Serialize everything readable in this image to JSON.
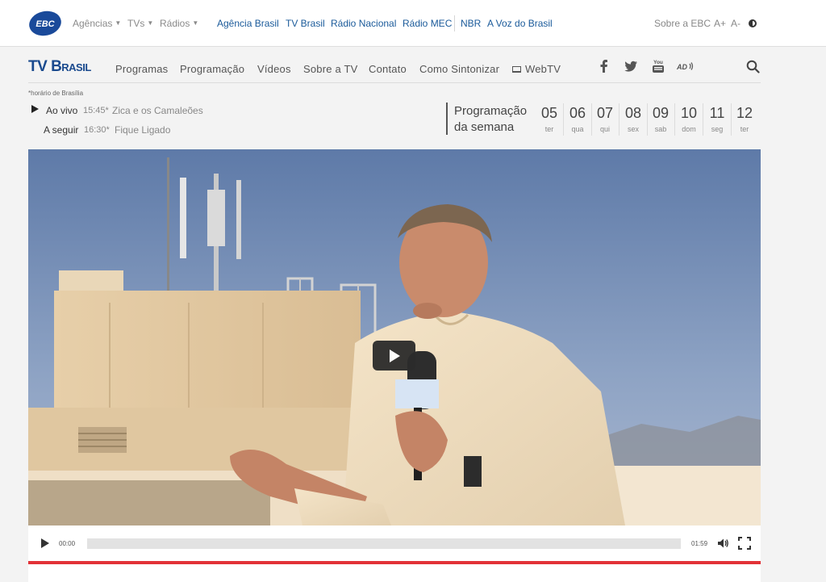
{
  "topbar": {
    "logo_text": "EBC",
    "dropdowns": [
      "Agências",
      "TVs",
      "Rádios"
    ],
    "links": [
      "Agência Brasil",
      "TV Brasil",
      "Rádio Nacional",
      "Rádio MEC",
      "NBR",
      "A Voz do Brasil"
    ],
    "about": "Sobre a EBC",
    "font_plus": "A+",
    "font_minus": "A-"
  },
  "nav": {
    "logo_main": "TV",
    "logo_sub": "Brasil",
    "items": [
      "Programas",
      "Programação",
      "Vídeos",
      "Sobre a TV",
      "Contato",
      "Como Sintonizar",
      "WebTV"
    ],
    "social_icons": [
      "facebook-icon",
      "twitter-icon",
      "youtube-icon",
      "audio-description-icon"
    ],
    "youtube_text": "You",
    "ad_text": "AD"
  },
  "schedule": {
    "timezone_note": "*horário de Brasília",
    "live_label": "Ao vivo",
    "live_time": "15:45*",
    "live_title": "Zica e os Camaleões",
    "next_label": "A seguir",
    "next_time": "16:30*",
    "next_title": "Fique Ligado",
    "week_title_1": "Programação",
    "week_title_2": "da semana",
    "days": [
      {
        "num": "05",
        "wd": "ter"
      },
      {
        "num": "06",
        "wd": "qua"
      },
      {
        "num": "07",
        "wd": "qui"
      },
      {
        "num": "08",
        "wd": "sex"
      },
      {
        "num": "09",
        "wd": "sab"
      },
      {
        "num": "10",
        "wd": "dom"
      },
      {
        "num": "11",
        "wd": "seg"
      },
      {
        "num": "12",
        "wd": "ter"
      }
    ]
  },
  "player": {
    "current_time": "00:00",
    "duration": "01:59",
    "progress": 0
  },
  "colors": {
    "brand_blue": "#1a4a8e",
    "accent_red": "#e23237"
  }
}
